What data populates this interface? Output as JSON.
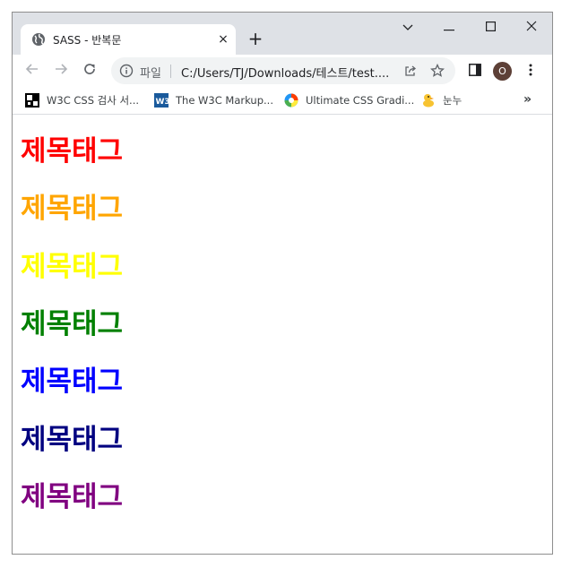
{
  "tab": {
    "title": "SASS - 반복문",
    "close": "×"
  },
  "new_tab": "+",
  "address_bar": {
    "scheme_label": "파일",
    "url": "C:/Users/TJ/Downloads/테스트/test...."
  },
  "profile": {
    "initial": "O"
  },
  "bookmarks": [
    {
      "label": "W3C CSS 검사 서..."
    },
    {
      "label": "The W3C Markup..."
    },
    {
      "label": "Ultimate CSS Gradi..."
    },
    {
      "label": "눈누"
    }
  ],
  "bookmarks_more": "»",
  "headings": [
    {
      "text": "제목태그",
      "color": "#ff0000"
    },
    {
      "text": "제목태그",
      "color": "#ffa500"
    },
    {
      "text": "제목태그",
      "color": "#ffff00"
    },
    {
      "text": "제목태그",
      "color": "#008000"
    },
    {
      "text": "제목태그",
      "color": "#0000ff"
    },
    {
      "text": "제목태그",
      "color": "#000080"
    },
    {
      "text": "제목태그",
      "color": "#800080"
    }
  ]
}
